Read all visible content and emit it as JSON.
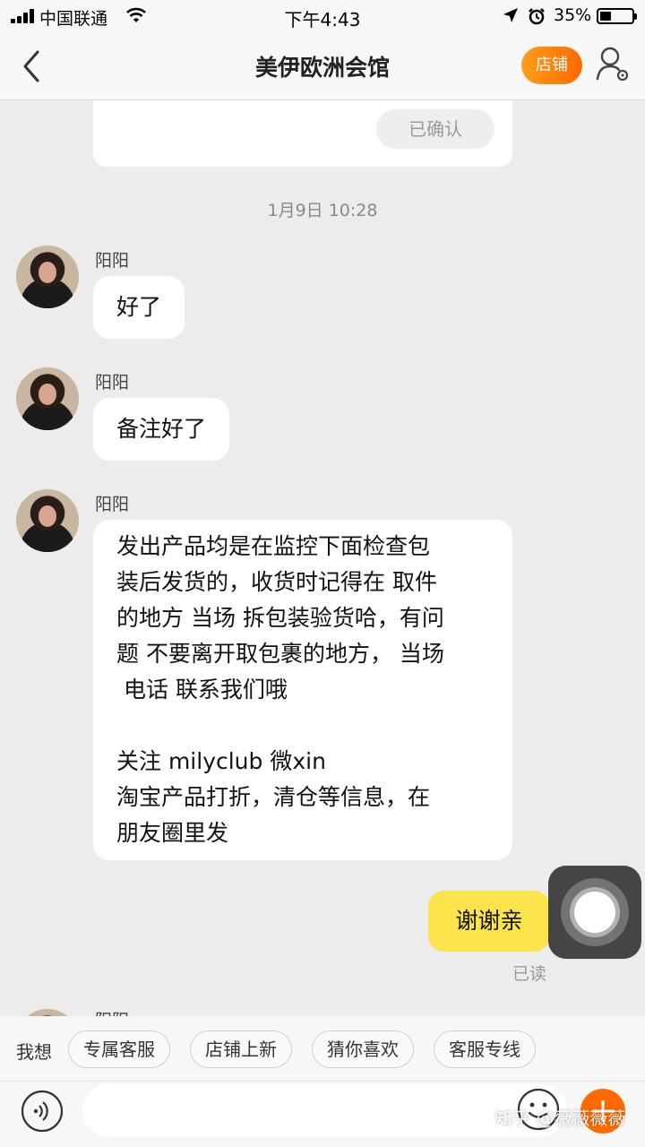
{
  "status_bar": {
    "carrier": "中国联通",
    "time": "下午4:43",
    "battery": "35%",
    "battery_level": 0.35
  },
  "nav": {
    "title": "美伊欧洲会馆",
    "shop_label": "店铺"
  },
  "chat": {
    "order_card": {
      "confirmed_label": "已确认"
    },
    "timestamp": "1月9日 10:28",
    "messages": [
      {
        "sender": "阳阳",
        "text": "好了"
      },
      {
        "sender": "阳阳",
        "text": "备注好了"
      },
      {
        "sender": "阳阳",
        "text": "发出产品均是在监控下面检查包\n装后发货的，收货时记得在 取件\n的地方 当场 拆包装验货哈，有问\n题 不要离开取包裹的地方， 当场\n 电话 联系我们哦\n\n关注 milyclub 微xin\n淘宝产品打折，清仓等信息，在\n朋友圈里发"
      },
      {
        "sender": "阳阳"
      }
    ],
    "my_message": "谢谢亲",
    "read_status": "已读"
  },
  "quick_replies": {
    "label": "我想",
    "chips": [
      "专属客服",
      "店铺上新",
      "猜你喜欢",
      "客服专线"
    ]
  },
  "input_bar": {
    "placeholder": ""
  },
  "watermark": "知乎 @薇薇薇薇",
  "colors": {
    "accent": "#ff6a00",
    "my_bubble": "#fbe34c",
    "background": "#ececec"
  }
}
